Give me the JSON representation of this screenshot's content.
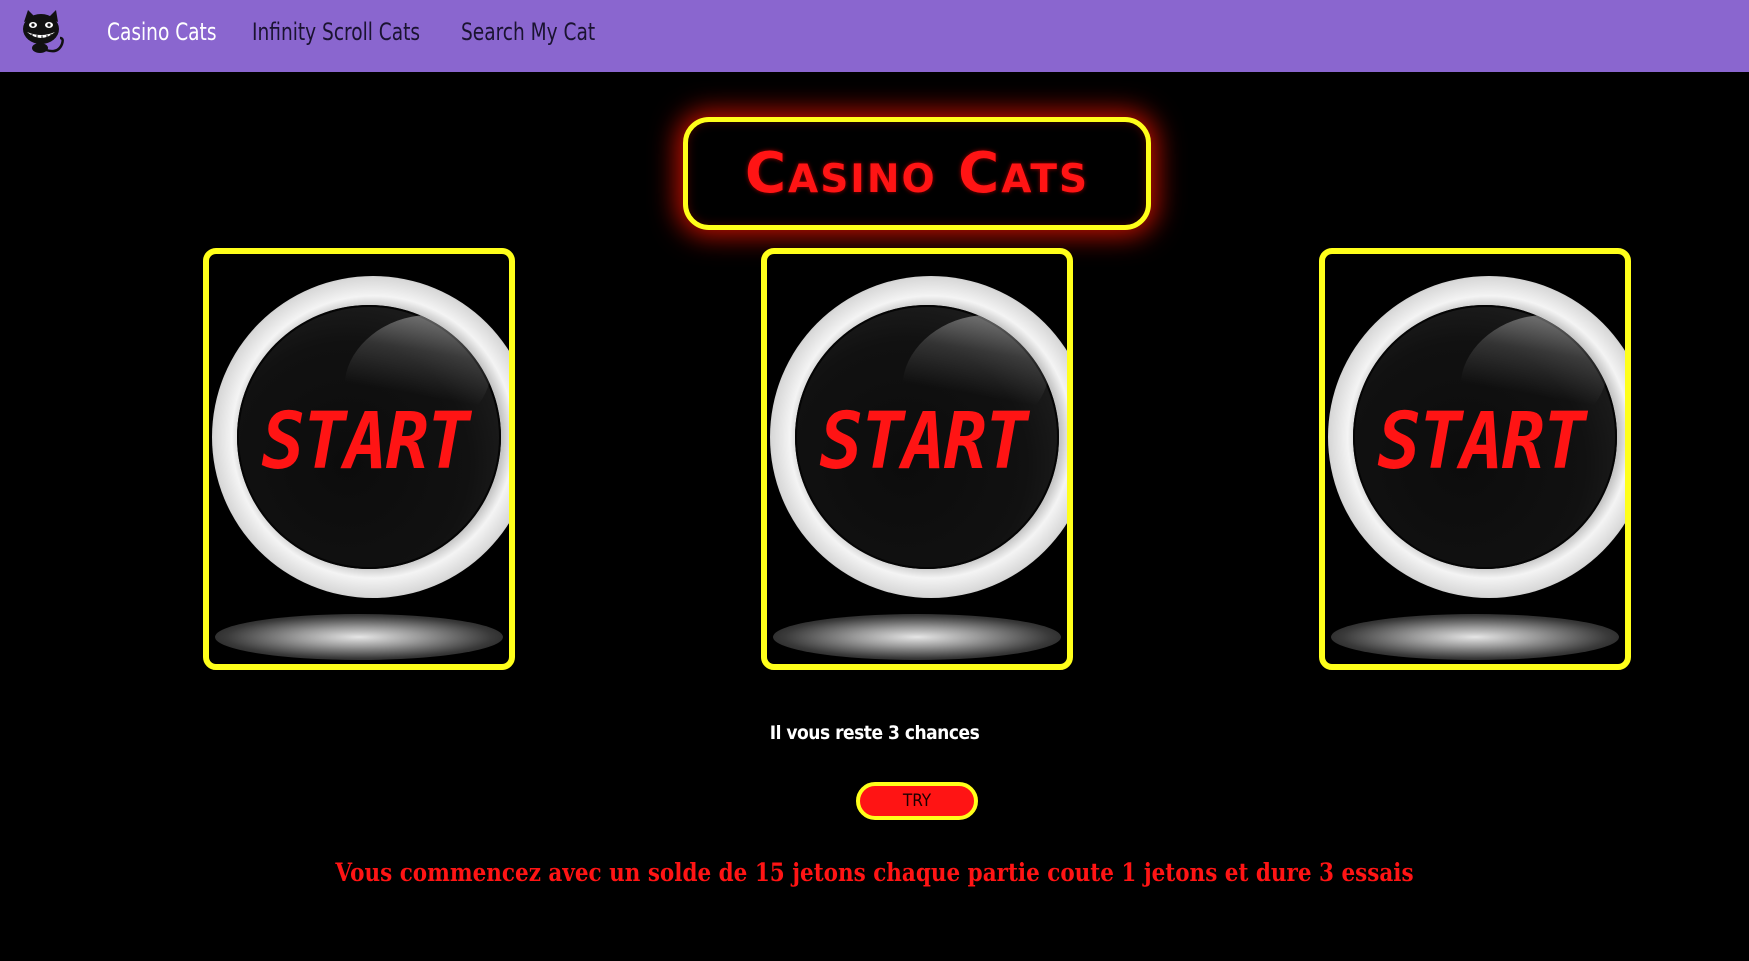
{
  "navbar": {
    "logo_icon": "grinning-cat-icon",
    "links": [
      {
        "label": "Casino Cats",
        "active": true
      },
      {
        "label": "Infinity Scroll Cats",
        "active": false
      },
      {
        "label": "Search My Cat",
        "active": false
      }
    ],
    "background_color": "#8a66cf"
  },
  "main": {
    "title": "Casino Cats",
    "slots": [
      {
        "label": "START"
      },
      {
        "label": "START"
      },
      {
        "label": "START"
      }
    ],
    "chances_text": "Il vous reste 3 chances",
    "try_label": "TRY",
    "info_text": "Vous commencez avec un solde de 15 jetons chaque partie coute 1 jetons et dure 3 essais"
  },
  "colors": {
    "accent_yellow": "#ffff1a",
    "accent_red": "#ff1414",
    "background": "#000000"
  }
}
